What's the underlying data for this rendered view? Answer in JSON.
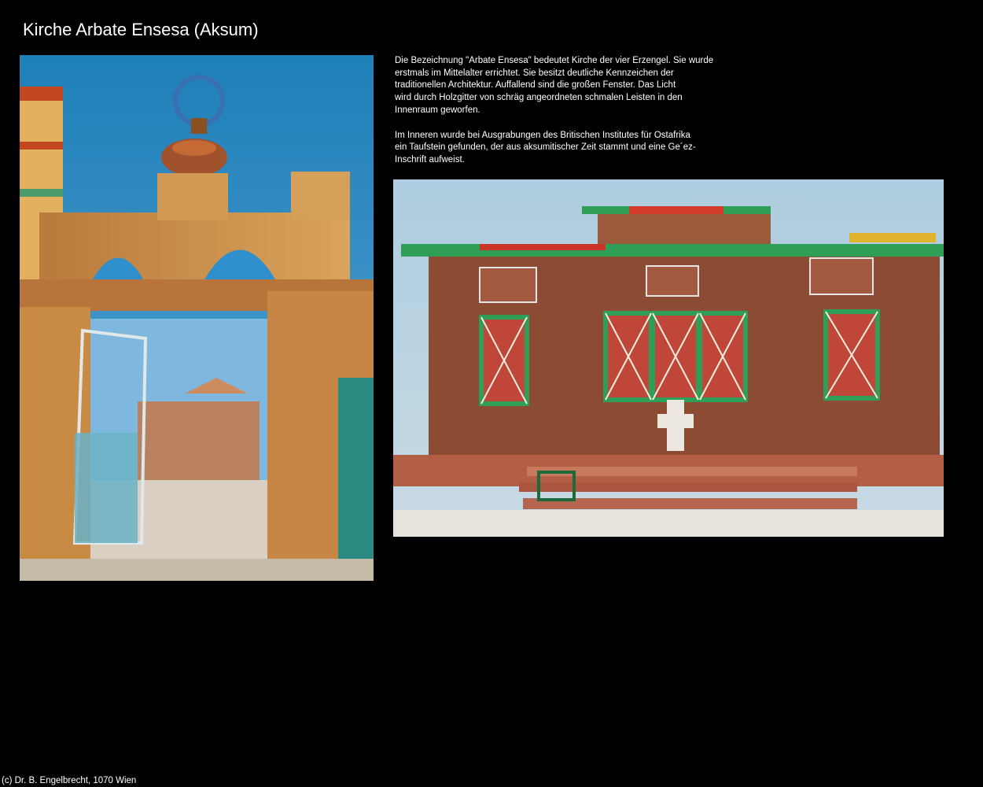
{
  "page": {
    "title": "Kirche Arbate Ensesa (Aksum)"
  },
  "description": {
    "paragraphs": [
      "Die Bezeichnung \"Arbate Ensesa\" bedeutet Kirche der vier Erzengel. Sie wurde\nerstmals im Mittelalter errichtet. Sie besitzt deutliche Kennzeichen der\ntraditionellen Architektur. Auffallend sind die großen Fenster. Das Licht\nwird durch Holzgitter von schräg angeordneten schmalen Leisten in den\nInnenraum geworfen.",
      "Im Inneren wurde bei Ausgrabungen des Britischen Institutes für Ostafrika\nein Taufstein gefunden, der aus aksumitischer Zeit stammt und eine Ge´ez-\nInschrift aufweist."
    ]
  },
  "footer": {
    "copyright": "(c) Dr. B. Engelbrecht, 1070 Wien"
  },
  "colors": {
    "background": "#000000",
    "text": "#ffffff"
  }
}
